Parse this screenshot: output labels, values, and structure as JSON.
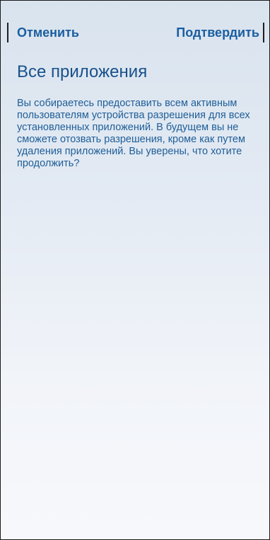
{
  "dialog": {
    "cancel_label": "Отменить",
    "confirm_label": "Подтвердить",
    "title": "Все приложения",
    "message": "Вы собираетесь предоставить всем активным пользователям устройства разрешения для всех установленных приложений. В будущем вы не сможете отозвать разрешения, кроме как путем удаления приложений. Вы уверены, что хотите продолжить?"
  },
  "colors": {
    "accent": "#1a5ea0",
    "title": "#18508a",
    "text": "#1f5e98",
    "background_top": "#d9e3ee",
    "background_bottom": "#f7f8fb"
  }
}
